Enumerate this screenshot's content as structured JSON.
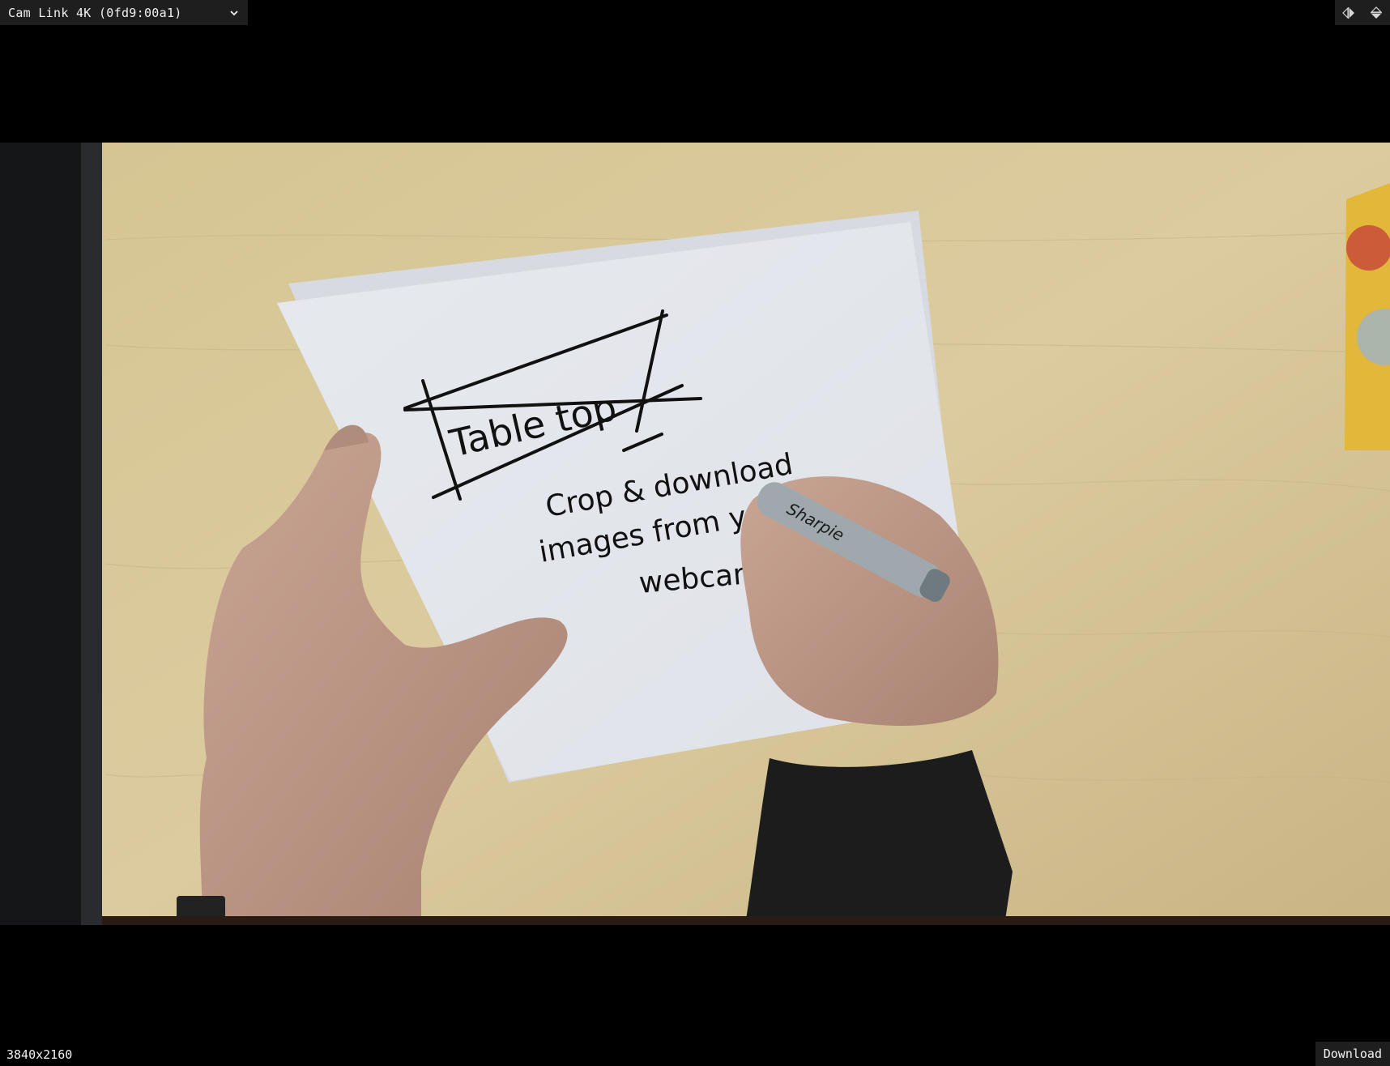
{
  "camera": {
    "selected": "Cam Link 4K (0fd9:00a1)"
  },
  "controls": {
    "mirror_icon": "flip-horizontal-icon",
    "flip_icon": "flip-vertical-icon"
  },
  "video": {
    "handwriting": {
      "title": "Table top",
      "line1": "Crop & download",
      "line2": "images from your",
      "line3": "webcam"
    },
    "marker_brand": "Sharpie"
  },
  "status": {
    "resolution": "3840x2160"
  },
  "actions": {
    "download_label": "Download"
  },
  "colors": {
    "background": "#000000",
    "control_bg": "#1e1e1e",
    "control_text": "#f2f2f2",
    "table_wood": "#d9c89a",
    "paper": "#e8ebef"
  }
}
